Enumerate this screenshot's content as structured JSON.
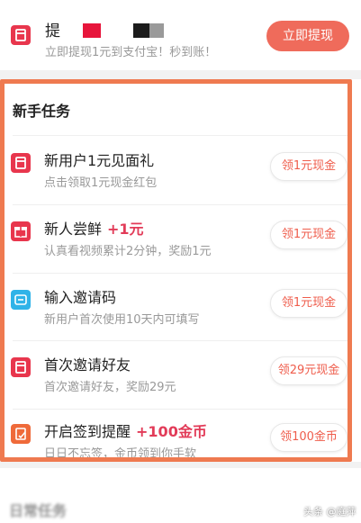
{
  "top": {
    "title": "提",
    "subtitle": "立即提现1元到支付宝！秒到账！",
    "button": "立即提现"
  },
  "section": {
    "title": "新手任务"
  },
  "tasks": [
    {
      "icon": "red-envelope-icon",
      "title": "新用户1元见面礼",
      "highlight": "",
      "subtitle": "点击领取1元现金红包",
      "button": "领1元现金"
    },
    {
      "icon": "gift-box-icon",
      "title": "新人尝鲜",
      "highlight": "+1元",
      "subtitle": "认真看视频累计2分钟，奖励1元",
      "button": "领1元现金"
    },
    {
      "icon": "invite-code-icon",
      "title": "输入邀请码",
      "highlight": "",
      "subtitle": "新用户首次使用10天内可填写",
      "button": "领1元现金"
    },
    {
      "icon": "red-envelope-icon",
      "title": "首次邀请好友",
      "highlight": "",
      "subtitle": "首次邀请好友，奖励29元",
      "button": "领29元现金"
    },
    {
      "icon": "sign-in-reminder-icon",
      "title": "开启签到提醒",
      "highlight": "+100金币",
      "subtitle": "日日不忘签，金币领到你手软",
      "button": "领100金币"
    }
  ],
  "daily": {
    "title": "日常任务"
  },
  "watermark": "头条 @庭萍",
  "colors": {
    "accent": "#ef6b5b",
    "highlight": "#e23b58",
    "frame": "#ef7a50"
  }
}
